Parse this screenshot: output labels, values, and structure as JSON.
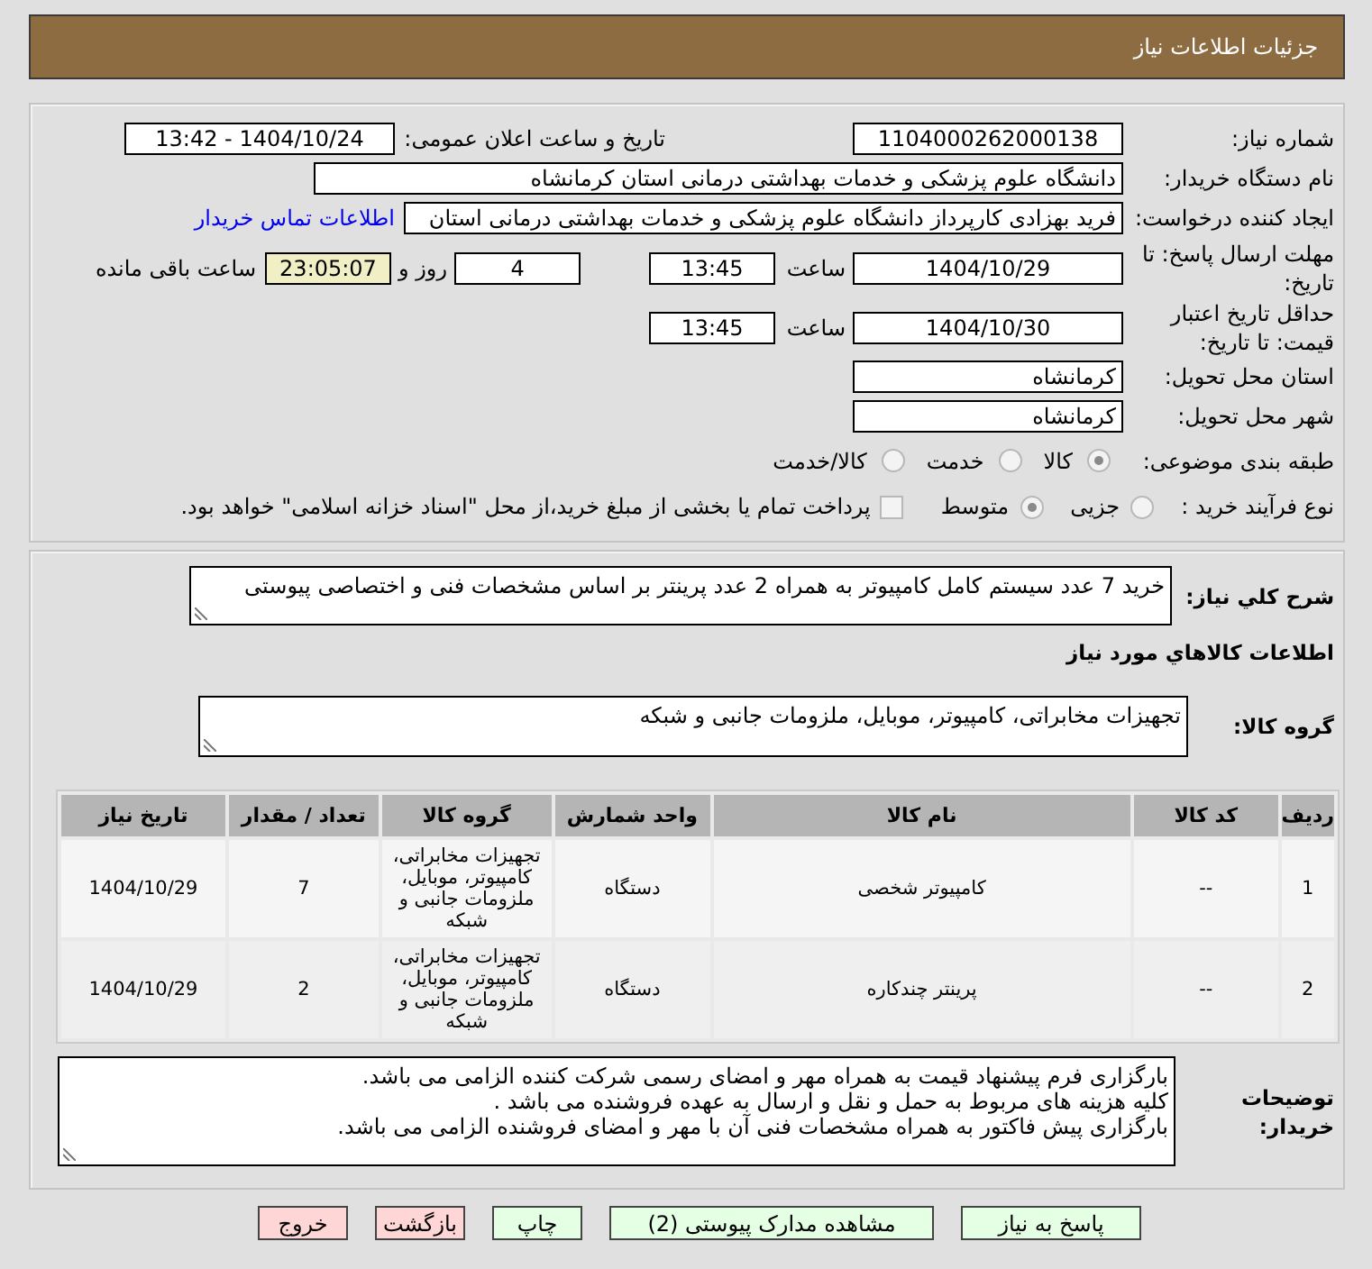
{
  "header": {
    "title": "جزئیات اطلاعات نیاز"
  },
  "details": {
    "need_number": {
      "label": "شماره نیاز:",
      "value": "1104000262000138"
    },
    "announce_datetime": {
      "label": "تاریخ و ساعت اعلان عمومی:",
      "value": "1404/10/24 - 13:42"
    },
    "buyer_org": {
      "label": "نام دستگاه خریدار:",
      "value": "دانشگاه علوم پزشکی و خدمات بهداشتی  درمانی استان کرمانشاه"
    },
    "requester": {
      "label": "ایجاد کننده درخواست:",
      "value": "فرید  بهزادی کارپرداز دانشگاه علوم پزشکی و خدمات بهداشتی  درمانی استان",
      "link": "اطلاعات تماس خریدار"
    },
    "response_deadline": {
      "label": "مهلت ارسال پاسخ: تا تاریخ:",
      "date": "1404/10/29",
      "time_label": "ساعت",
      "time": "13:45",
      "days": "4",
      "days_label": "روز و",
      "remaining": "23:05:07",
      "remaining_label": "ساعت باقی مانده"
    },
    "price_validity": {
      "label": "حداقل تاریخ اعتبار قیمت: تا تاریخ:",
      "date": "1404/10/30",
      "time_label": "ساعت",
      "time": "13:45"
    },
    "delivery_province": {
      "label": "استان محل تحویل:",
      "value": "کرمانشاه"
    },
    "delivery_city": {
      "label": "شهر محل تحویل:",
      "value": "کرمانشاه"
    },
    "subject_category": {
      "label": "طبقه بندی موضوعی:",
      "options": [
        {
          "label": "کالا",
          "selected": true
        },
        {
          "label": "خدمت",
          "selected": false
        },
        {
          "label": "کالا/خدمت",
          "selected": false
        }
      ]
    },
    "purchase_process": {
      "label": "نوع فرآیند خرید :",
      "options": [
        {
          "label": "جزیی",
          "selected": false
        },
        {
          "label": "متوسط",
          "selected": true
        }
      ],
      "treasury_payment": {
        "label": "پرداخت تمام یا بخشی از مبلغ خرید،از محل \"اسناد خزانه اسلامی\" خواهد بود.",
        "checked": false
      }
    }
  },
  "description": {
    "label": "شرح کلي نياز:",
    "value": "خرید 7 عدد سیستم کامل کامپیوتر به همراه 2 عدد پرینتر بر اساس مشخصات فنی و اختصاصی پیوستی"
  },
  "goods": {
    "title": "اطلاعات کالاهاي مورد نياز",
    "group_label": "گروه کالا:",
    "group_value": "تجهیزات مخابراتی، کامپیوتر، موبایل، ملزومات جانبی و شبکه",
    "table": {
      "columns": [
        "ردیف",
        "کد کالا",
        "نام کالا",
        "واحد شمارش",
        "گروه کالا",
        "تعداد / مقدار",
        "تاریخ نیاز"
      ],
      "rows": [
        [
          "1",
          "--",
          "کامپیوتر شخصی",
          "دستگاه",
          "تجهیزات مخابراتی، کامپیوتر، موبایل، ملزومات جانبی و شبکه",
          "7",
          "1404/10/29"
        ],
        [
          "2",
          "--",
          "پرینتر چندکاره",
          "دستگاه",
          "تجهیزات مخابراتی، کامپیوتر، موبایل، ملزومات جانبی و شبکه",
          "2",
          "1404/10/29"
        ]
      ]
    }
  },
  "buyer_notes": {
    "label": "توضیحات خریدار:",
    "lines": [
      "بارگزاری فرم پیشنهاد قیمت به همراه مهر و امضای رسمی شرکت کننده الزامی می باشد.",
      "کلیه هزینه های مربوط به حمل و نقل و ارسال به عهده فروشنده می باشد .",
      "بارگزاری پیش فاکتور به همراه مشخصات فنی آن با مهر و امضای فروشنده الزامی می باشد."
    ]
  },
  "buttons": [
    {
      "label": "پاسخ به نیاز",
      "kind": "confirm"
    },
    {
      "label": "مشاهده مدارک پیوستی (2)",
      "kind": "confirm"
    },
    {
      "label": "چاپ",
      "kind": "confirm"
    },
    {
      "label": "بازگشت",
      "kind": "cancel"
    },
    {
      "label": "خروج",
      "kind": "cancel"
    }
  ]
}
